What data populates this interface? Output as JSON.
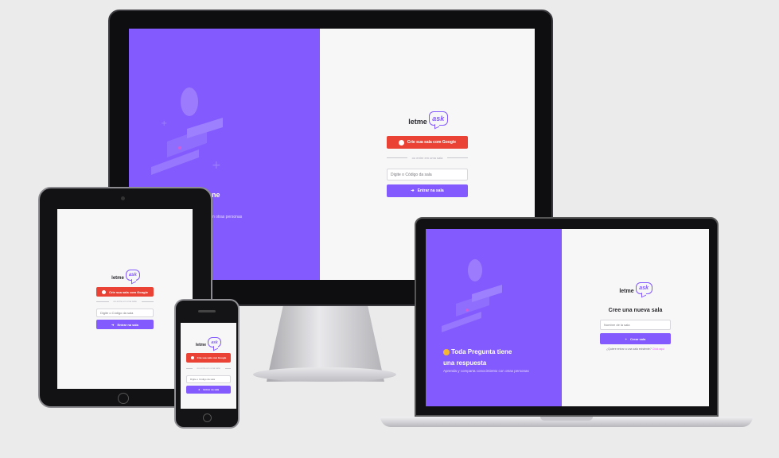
{
  "brand": {
    "logo_text": "letme",
    "logo_accent": "ask"
  },
  "desktop": {
    "google_button": "Crie sua sala com Google",
    "separator": "ou entre em uma sala",
    "room_code_placeholder": "Digite o Código da sala",
    "enter_button": "Entrar na sala",
    "headline_fragment": "ntiene",
    "tagline_fragment": "nto com otras personas"
  },
  "tablet": {
    "google_button": "Crie sua sala com Google",
    "separator": "ou entre em uma sala",
    "room_code_placeholder": "Digite o Código da sala",
    "enter_button": "Entrar na sala"
  },
  "phone": {
    "google_button": "Crie sua sala com Google",
    "separator": "ou entre em uma sala",
    "room_code_placeholder": "Digite o Código da sala",
    "enter_button": "Entrar na sala"
  },
  "laptop": {
    "headline_line1": "Toda Pregunta tiene",
    "headline_line2": "una respuesta",
    "tagline": "Aprenda y comparta conocimiento con otras personas",
    "form_title": "Cree una nueva sala",
    "room_name_placeholder": "Nombre de la sala",
    "create_button": "Crear sala",
    "join_prompt": "¿Quiere entrar a una sala existente?",
    "join_link": "Click aqui"
  },
  "colors": {
    "primary": "#835afd",
    "google": "#ea4335",
    "background": "#f7f7f8",
    "emoji": "#f5b731"
  }
}
